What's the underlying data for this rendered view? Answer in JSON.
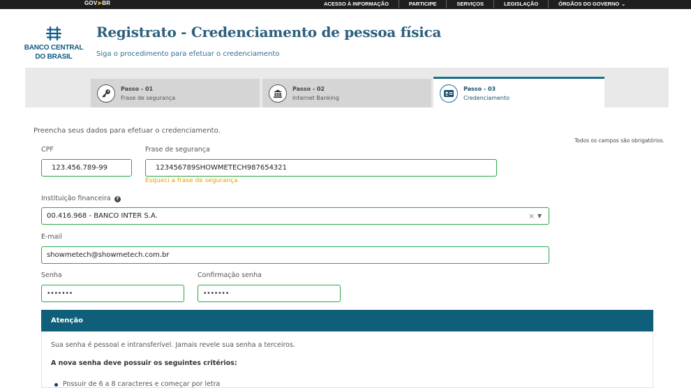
{
  "gov_bar": {
    "logo_text": "GOV",
    "logo_suffix": "BR",
    "nav": [
      "ACESSO À INFORMAÇÃO",
      "PARTICIPE",
      "SERVIÇOS",
      "LEGISLAÇÃO",
      "ÓRGÃOS DO GOVERNO"
    ]
  },
  "logo": {
    "line1": "BANCO CENTRAL",
    "line2": "DO BRASIL"
  },
  "header": {
    "title": "Registrato - Credenciamento de pessoa física",
    "subtitle": "Siga o procedimento para efetuar o credenciamento"
  },
  "steps": [
    {
      "number": "Passo - 01",
      "label": "Frase de segurança",
      "icon": "key-icon",
      "active": false
    },
    {
      "number": "Passo - 02",
      "label": "Internet Banking",
      "icon": "bank-icon",
      "active": false
    },
    {
      "number": "Passo - 03",
      "label": "Credenciamento",
      "icon": "id-card-icon",
      "active": true
    }
  ],
  "form": {
    "intro": "Preencha seus dados para efetuar o credenciamento.",
    "required_note": "Todos os campos são obrigatórios.",
    "cpf_label": "CPF",
    "cpf_value": "123.456.789-99",
    "phrase_label": "Frase de segurança",
    "phrase_value": "123456789SHOWMETECH987654321",
    "forgot_link": "Esqueci a frase de segurança",
    "institution_label": "Instituição financeira",
    "institution_value": "00.416.968 - BANCO INTER S.A.",
    "email_label": "E-mail",
    "email_value": "showmetech@showmetech.com.br",
    "password_label": "Senha",
    "password_value": "•••••••",
    "confirm_label": "Confirmação senha",
    "confirm_value": "•••••••"
  },
  "attention": {
    "title": "Atenção",
    "text1": "Sua senha é pessoal e intransferível. Jamais revele sua senha a terceiros.",
    "criteria_title": "A nova senha deve possuir os seguintes critérios:",
    "criteria": [
      "Possuir de 6 a 8 caracteres e começar por letra"
    ]
  },
  "colors": {
    "gov_bar": "#1f1f1f",
    "brand": "#0d5a86",
    "valid_border": "#28a745",
    "link_warning": "#e6a100",
    "attention_header": "#0f5e7a"
  }
}
